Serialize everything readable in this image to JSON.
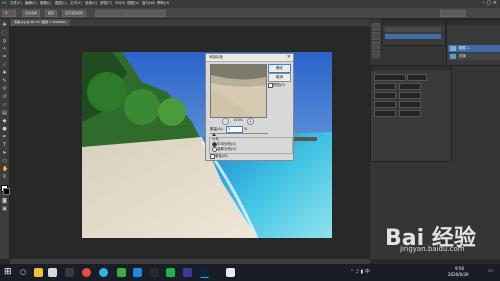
{
  "menu": {
    "items": [
      "文件(F)",
      "编辑(E)",
      "图像(I)",
      "图层(L)",
      "文字(Y)",
      "选择(S)",
      "滤镜(T)",
      "3D(D)",
      "视图(V)",
      "窗口(W)",
      "帮助(H)"
    ]
  },
  "options": {
    "items": [
      "自动选择",
      "图层",
      "显示变换控件"
    ]
  },
  "document": {
    "tab": "海滩.jpg @ 66.7% (图层 1, RGB/8#)"
  },
  "dialog": {
    "title": "添加杂色",
    "close": "×",
    "buttons": {
      "ok": "确定",
      "cancel": "取消",
      "preview": "预览(P)"
    },
    "zoom_percent": "100%",
    "zoom_out": "−",
    "zoom_in": "+",
    "amount_label": "数量(A):",
    "amount_value": "3",
    "amount_unit": "%",
    "distribution_label": "分布",
    "uniform": "平均分布(U)",
    "gaussian": "高斯分布(G)",
    "monochrome": "单色(M)"
  },
  "layers": {
    "layer1": "图层 1",
    "background": "背景"
  },
  "taskbar": {
    "time": "9:56",
    "date": "2020/6/30"
  },
  "watermark": {
    "text": "Bai 经验",
    "url": "jingyan.baidu.com"
  },
  "colors": {
    "ps_dark": "#282828",
    "ps_panel": "#3a3a3a",
    "layer_selected": "#3d6ca6",
    "taskbar": "#191d26"
  }
}
